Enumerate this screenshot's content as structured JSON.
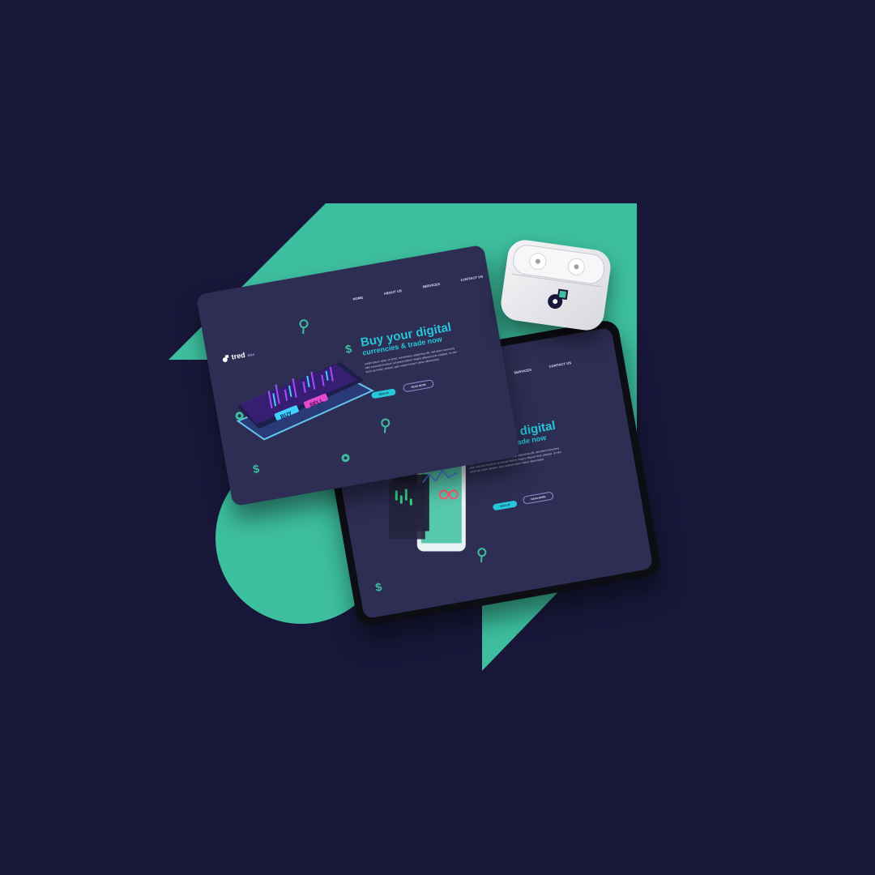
{
  "brand": {
    "name": "tred",
    "sub": "ERA"
  },
  "nav": [
    "HOME",
    "ABOUT US",
    "SERVICES",
    "CONTACT US"
  ],
  "hero": {
    "title_line1": "Buy your digital",
    "title_line2": "currencies & trade now",
    "body": "Lorem ipsum dolor sit amet, consectetur adipiscing elit, sed diam nonummy nibh euismod tincidunt ut laoreet dolore magna aliquam erat volutpat. Ut wisi enim ad minim veniam, quis nostrud exerci tation ullamcorper.",
    "primary_button": "SIGN UP",
    "secondary_button": "READ MORE"
  },
  "illustration": {
    "buy_label": "BUY",
    "sell_label": "SELL"
  },
  "colors": {
    "background": "#18173a",
    "accent_green": "#3dbf9f",
    "screen_bg": "#2e2e55",
    "title_cyan": "#27c6d8"
  }
}
